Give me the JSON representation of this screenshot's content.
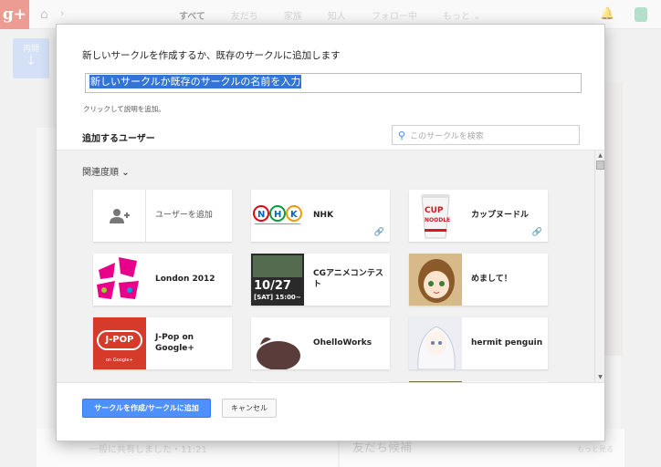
{
  "topbar": {
    "logo": "g+",
    "nav": [
      "すべて",
      "友だち",
      "家族",
      "知人",
      "フォロー中",
      "もっと"
    ]
  },
  "background": {
    "left_button": "再開",
    "post_text": "一般に共有しました・11:21",
    "suggest_title": "友だち候補",
    "suggest_more": "もっと見る"
  },
  "dialog": {
    "title": "新しいサークルを作成するか、既存のサークルに追加します",
    "name_input_value": "新しいサークルか既存のサークルの名前を入力",
    "description_link": "クリックして説明を追加。",
    "tab_label": "追加するユーザー",
    "search_placeholder": "このサークルを検索",
    "sort_label": "関連度順",
    "cards": [
      {
        "name": "ユーザーを追加",
        "icon": "add-person-icon"
      },
      {
        "name": "NHK",
        "icon": "link-icon"
      },
      {
        "name": "カップヌードル",
        "icon": "link-icon"
      },
      {
        "name": "London 2012"
      },
      {
        "name": "CGアニメコンテスト"
      },
      {
        "name": "めまして！"
      },
      {
        "name": "J-Pop on Google+"
      },
      {
        "name": "OhelloWorks"
      },
      {
        "name": "hermit penguin"
      }
    ],
    "primary_button": "サークルを作成/サークルに追加",
    "cancel_button": "キャンセル",
    "thumb_text": {
      "cgac_date": "10/27",
      "cgac_time": "[SAT] 15:00~",
      "jpop_logo": "J-POP",
      "jpop_sub": "on Google+",
      "cup_text": "CUP NOODLE"
    }
  },
  "colors": {
    "accent": "#4d90fe",
    "gplus_red": "#dd4b39",
    "selection": "#3375d6"
  }
}
